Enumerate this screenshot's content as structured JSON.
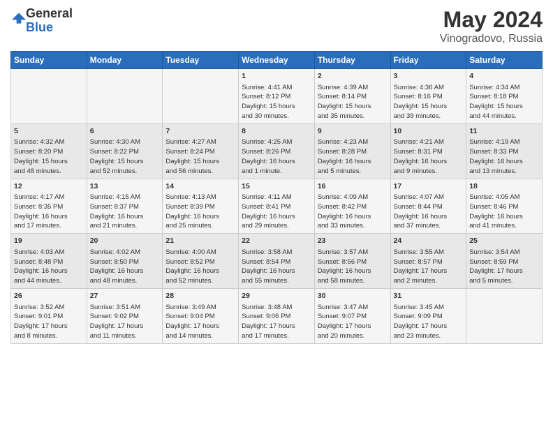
{
  "logo": {
    "general": "General",
    "blue": "Blue"
  },
  "title": "May 2024",
  "subtitle": "Vinogradovo, Russia",
  "columns": [
    "Sunday",
    "Monday",
    "Tuesday",
    "Wednesday",
    "Thursday",
    "Friday",
    "Saturday"
  ],
  "rows": [
    [
      {
        "day": "",
        "content": ""
      },
      {
        "day": "",
        "content": ""
      },
      {
        "day": "",
        "content": ""
      },
      {
        "day": "1",
        "content": "Sunrise: 4:41 AM\nSunset: 8:12 PM\nDaylight: 15 hours\nand 30 minutes."
      },
      {
        "day": "2",
        "content": "Sunrise: 4:39 AM\nSunset: 8:14 PM\nDaylight: 15 hours\nand 35 minutes."
      },
      {
        "day": "3",
        "content": "Sunrise: 4:36 AM\nSunset: 8:16 PM\nDaylight: 15 hours\nand 39 minutes."
      },
      {
        "day": "4",
        "content": "Sunrise: 4:34 AM\nSunset: 8:18 PM\nDaylight: 15 hours\nand 44 minutes."
      }
    ],
    [
      {
        "day": "5",
        "content": "Sunrise: 4:32 AM\nSunset: 8:20 PM\nDaylight: 15 hours\nand 48 minutes."
      },
      {
        "day": "6",
        "content": "Sunrise: 4:30 AM\nSunset: 8:22 PM\nDaylight: 15 hours\nand 52 minutes."
      },
      {
        "day": "7",
        "content": "Sunrise: 4:27 AM\nSunset: 8:24 PM\nDaylight: 15 hours\nand 56 minutes."
      },
      {
        "day": "8",
        "content": "Sunrise: 4:25 AM\nSunset: 8:26 PM\nDaylight: 16 hours\nand 1 minute."
      },
      {
        "day": "9",
        "content": "Sunrise: 4:23 AM\nSunset: 8:28 PM\nDaylight: 16 hours\nand 5 minutes."
      },
      {
        "day": "10",
        "content": "Sunrise: 4:21 AM\nSunset: 8:31 PM\nDaylight: 16 hours\nand 9 minutes."
      },
      {
        "day": "11",
        "content": "Sunrise: 4:19 AM\nSunset: 8:33 PM\nDaylight: 16 hours\nand 13 minutes."
      }
    ],
    [
      {
        "day": "12",
        "content": "Sunrise: 4:17 AM\nSunset: 8:35 PM\nDaylight: 16 hours\nand 17 minutes."
      },
      {
        "day": "13",
        "content": "Sunrise: 4:15 AM\nSunset: 8:37 PM\nDaylight: 16 hours\nand 21 minutes."
      },
      {
        "day": "14",
        "content": "Sunrise: 4:13 AM\nSunset: 8:39 PM\nDaylight: 16 hours\nand 25 minutes."
      },
      {
        "day": "15",
        "content": "Sunrise: 4:11 AM\nSunset: 8:41 PM\nDaylight: 16 hours\nand 29 minutes."
      },
      {
        "day": "16",
        "content": "Sunrise: 4:09 AM\nSunset: 8:42 PM\nDaylight: 16 hours\nand 33 minutes."
      },
      {
        "day": "17",
        "content": "Sunrise: 4:07 AM\nSunset: 8:44 PM\nDaylight: 16 hours\nand 37 minutes."
      },
      {
        "day": "18",
        "content": "Sunrise: 4:05 AM\nSunset: 8:46 PM\nDaylight: 16 hours\nand 41 minutes."
      }
    ],
    [
      {
        "day": "19",
        "content": "Sunrise: 4:03 AM\nSunset: 8:48 PM\nDaylight: 16 hours\nand 44 minutes."
      },
      {
        "day": "20",
        "content": "Sunrise: 4:02 AM\nSunset: 8:50 PM\nDaylight: 16 hours\nand 48 minutes."
      },
      {
        "day": "21",
        "content": "Sunrise: 4:00 AM\nSunset: 8:52 PM\nDaylight: 16 hours\nand 52 minutes."
      },
      {
        "day": "22",
        "content": "Sunrise: 3:58 AM\nSunset: 8:54 PM\nDaylight: 16 hours\nand 55 minutes."
      },
      {
        "day": "23",
        "content": "Sunrise: 3:57 AM\nSunset: 8:56 PM\nDaylight: 16 hours\nand 58 minutes."
      },
      {
        "day": "24",
        "content": "Sunrise: 3:55 AM\nSunset: 8:57 PM\nDaylight: 17 hours\nand 2 minutes."
      },
      {
        "day": "25",
        "content": "Sunrise: 3:54 AM\nSunset: 8:59 PM\nDaylight: 17 hours\nand 5 minutes."
      }
    ],
    [
      {
        "day": "26",
        "content": "Sunrise: 3:52 AM\nSunset: 9:01 PM\nDaylight: 17 hours\nand 8 minutes."
      },
      {
        "day": "27",
        "content": "Sunrise: 3:51 AM\nSunset: 9:02 PM\nDaylight: 17 hours\nand 11 minutes."
      },
      {
        "day": "28",
        "content": "Sunrise: 3:49 AM\nSunset: 9:04 PM\nDaylight: 17 hours\nand 14 minutes."
      },
      {
        "day": "29",
        "content": "Sunrise: 3:48 AM\nSunset: 9:06 PM\nDaylight: 17 hours\nand 17 minutes."
      },
      {
        "day": "30",
        "content": "Sunrise: 3:47 AM\nSunset: 9:07 PM\nDaylight: 17 hours\nand 20 minutes."
      },
      {
        "day": "31",
        "content": "Sunrise: 3:45 AM\nSunset: 9:09 PM\nDaylight: 17 hours\nand 23 minutes."
      },
      {
        "day": "",
        "content": ""
      }
    ]
  ]
}
